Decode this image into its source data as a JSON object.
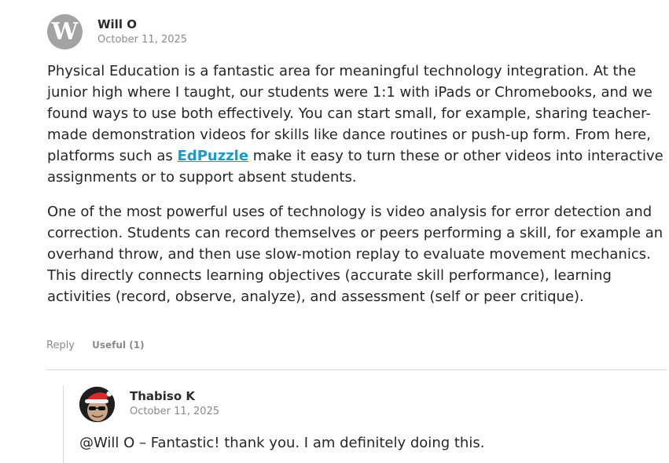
{
  "comment": {
    "avatar_letter": "W",
    "author": "Will O",
    "date": "October 11, 2025",
    "paragraph1_before_link": "Physical Education is a fantastic area for meaningful technology integration. At the junior high where I taught, our students were 1:1 with iPads or Chromebooks, and we found ways to use both effectively. You can start small, for example, sharing teacher-made demonstration videos for skills like dance routines or push-up form. From here, platforms such as ",
    "link_text": "EdPuzzle",
    "paragraph1_after_link": " make it easy to turn these or other videos into interactive assignments or to support absent students.",
    "paragraph2": "One of the most powerful uses of technology is video analysis for error detection and correction. Students can record themselves or peers performing a skill, for example an overhand throw, and then use slow-motion replay to evaluate movement mechanics. This directly connects learning objectives (accurate skill performance), learning activities (record, observe, analyze), and assessment (self or peer critique).",
    "reply_label": "Reply",
    "useful_label": "Useful (1)"
  },
  "reply": {
    "author": "Thabiso K",
    "date": "October 11, 2025",
    "text": "@Will O – Fantastic! thank you. I am definitely doing this."
  },
  "colors": {
    "link": "#1a9ac8",
    "avatar_gray": "#a3a3a3",
    "meta_gray": "#8b8b8b",
    "divider": "#d9d9d9"
  }
}
